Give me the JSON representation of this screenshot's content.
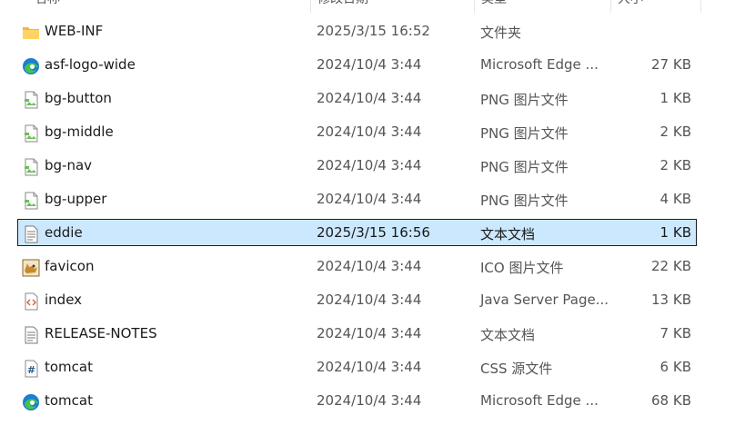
{
  "columns": {
    "name": "名称",
    "modified": "修改日期",
    "type": "类型",
    "size": "大小"
  },
  "files": [
    {
      "name": "WEB-INF",
      "modified": "2025/3/15 16:52",
      "type": "文件夹",
      "size": "",
      "icon": "folder-icon",
      "selected": false
    },
    {
      "name": "asf-logo-wide",
      "modified": "2024/10/4 3:44",
      "type": "Microsoft Edge ...",
      "size": "27 KB",
      "icon": "edge-icon",
      "selected": false
    },
    {
      "name": "bg-button",
      "modified": "2024/10/4 3:44",
      "type": "PNG 图片文件",
      "size": "1 KB",
      "icon": "png-image-icon",
      "selected": false
    },
    {
      "name": "bg-middle",
      "modified": "2024/10/4 3:44",
      "type": "PNG 图片文件",
      "size": "2 KB",
      "icon": "png-image-icon",
      "selected": false
    },
    {
      "name": "bg-nav",
      "modified": "2024/10/4 3:44",
      "type": "PNG 图片文件",
      "size": "2 KB",
      "icon": "png-image-icon",
      "selected": false
    },
    {
      "name": "bg-upper",
      "modified": "2024/10/4 3:44",
      "type": "PNG 图片文件",
      "size": "4 KB",
      "icon": "png-image-icon",
      "selected": false
    },
    {
      "name": "eddie",
      "modified": "2025/3/15 16:56",
      "type": "文本文档",
      "size": "1 KB",
      "icon": "text-file-icon",
      "selected": true
    },
    {
      "name": "favicon",
      "modified": "2024/10/4 3:44",
      "type": "ICO 图片文件",
      "size": "22 KB",
      "icon": "tomcat-favicon-icon",
      "selected": false
    },
    {
      "name": "index",
      "modified": "2024/10/4 3:44",
      "type": "Java Server Page...",
      "size": "13 KB",
      "icon": "code-file-icon",
      "selected": false
    },
    {
      "name": "RELEASE-NOTES",
      "modified": "2024/10/4 3:44",
      "type": "文本文档",
      "size": "7 KB",
      "icon": "text-file-icon",
      "selected": false
    },
    {
      "name": "tomcat",
      "modified": "2024/10/4 3:44",
      "type": "CSS 源文件",
      "size": "6 KB",
      "icon": "css-file-icon",
      "selected": false
    },
    {
      "name": "tomcat",
      "modified": "2024/10/4 3:44",
      "type": "Microsoft Edge ...",
      "size": "68 KB",
      "icon": "edge-icon",
      "selected": false
    }
  ],
  "colors": {
    "selection": "#cce8ff",
    "folder": "#f6c34a",
    "edge_blue": "#1a7fd4",
    "edge_green": "#45c24b"
  }
}
